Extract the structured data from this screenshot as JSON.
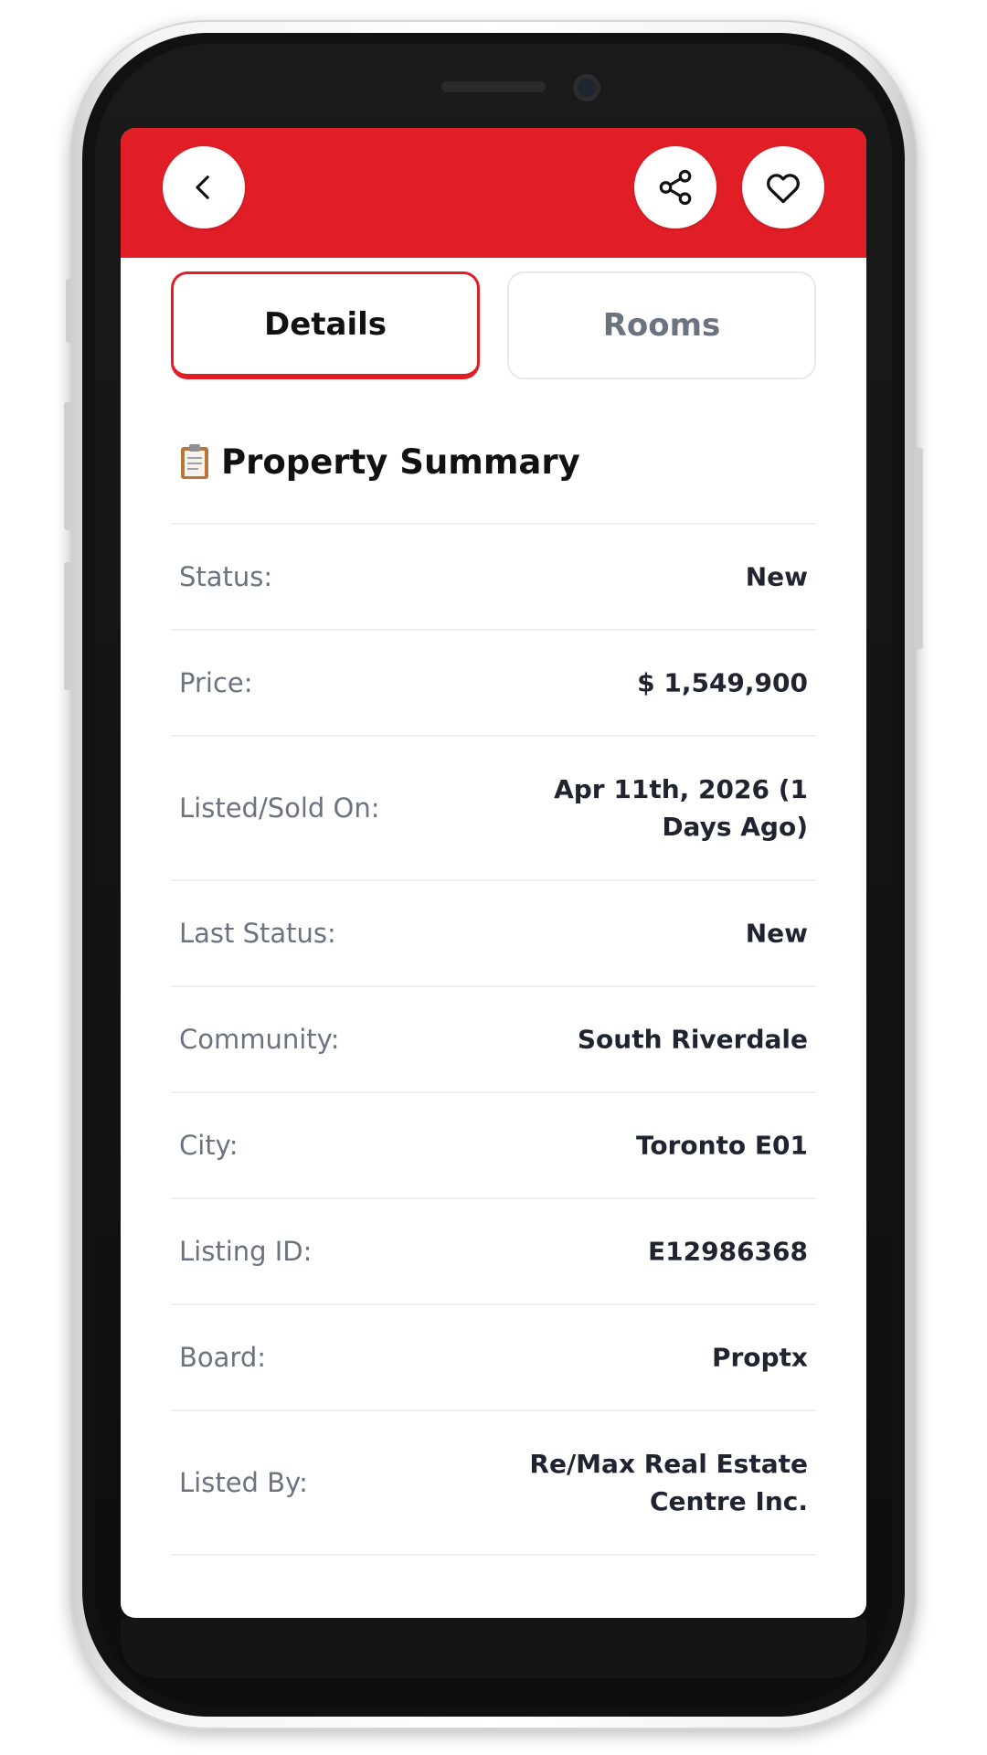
{
  "header": {
    "back_icon": "chevron-left-icon",
    "share_icon": "share-icon",
    "favorite_icon": "heart-icon",
    "accent_color": "#e11d26"
  },
  "tabs": [
    {
      "label": "Details",
      "active": true
    },
    {
      "label": "Rooms",
      "active": false
    }
  ],
  "summary": {
    "icon": "clipboard-icon",
    "title": "Property Summary",
    "rows": [
      {
        "label": "Status:",
        "value": "New"
      },
      {
        "label": "Price:",
        "value": "$ 1,549,900"
      },
      {
        "label": "Listed/Sold On:",
        "value": "Apr 11th, 2026 (1 Days Ago)"
      },
      {
        "label": "Last Status:",
        "value": "New"
      },
      {
        "label": "Community:",
        "value": "South Riverdale"
      },
      {
        "label": "City:",
        "value": "Toronto E01"
      },
      {
        "label": "Listing ID:",
        "value": "E12986368"
      },
      {
        "label": "Board:",
        "value": "Proptx"
      },
      {
        "label": "Listed By:",
        "value": "Re/Max Real Estate Centre Inc."
      }
    ]
  }
}
